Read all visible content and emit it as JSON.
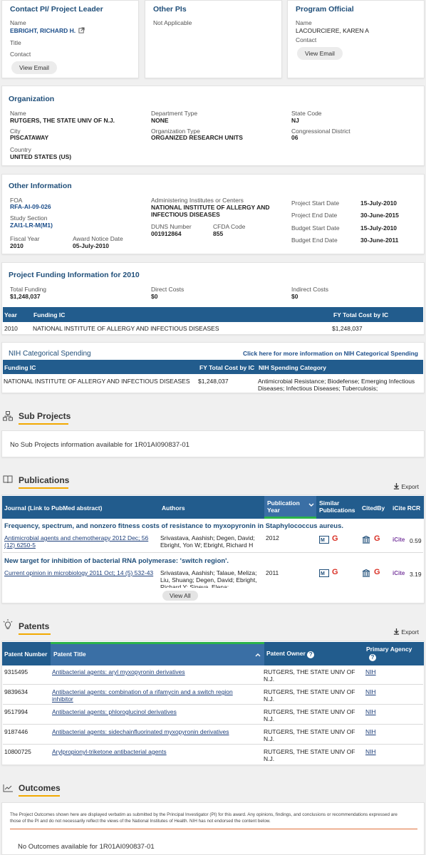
{
  "leaders": {
    "pi": {
      "title": "Contact PI/ Project Leader",
      "name_label": "Name",
      "name": "EBRIGHT, RICHARD H.",
      "title_label": "Title",
      "contact_label": "Contact",
      "button": "View Email"
    },
    "other": {
      "title": "Other PIs",
      "value": "Not Applicable"
    },
    "po": {
      "title": "Program Official",
      "name_label": "Name",
      "name": "LACOURCIERE, KAREN A",
      "contact_label": "Contact",
      "button": "View Email"
    }
  },
  "organization": {
    "title": "Organization",
    "name_label": "Name",
    "name": "RUTGERS, THE STATE UNIV OF N.J.",
    "city_label": "City",
    "city": "PISCATAWAY",
    "country_label": "Country",
    "country": "UNITED STATES (US)",
    "dept_label": "Department Type",
    "dept": "NONE",
    "orgtype_label": "Organization Type",
    "orgtype": "ORGANIZED RESEARCH UNITS",
    "state_label": "State Code",
    "state": "NJ",
    "district_label": "Congressional District",
    "district": "06"
  },
  "other_info": {
    "title": "Other Information",
    "foa_label": "FOA",
    "foa": "RFA-AI-09-026",
    "study_label": "Study Section",
    "study": "ZAI1-LR-M(M1)",
    "fy_label": "Fiscal Year",
    "fy": "2010",
    "award_label": "Award Notice Date",
    "award": "05-July-2010",
    "admin_label": "Administering Institutes or Centers",
    "admin": "NATIONAL INSTITUTE OF ALLERGY AND INFECTIOUS DISEASES",
    "duns_label": "DUNS Number",
    "duns": "001912864",
    "cfda_label": "CFDA Code",
    "cfda": "855",
    "dates": [
      {
        "label": "Project Start Date",
        "value": "15-July-2010"
      },
      {
        "label": "Project End Date",
        "value": "30-June-2015"
      },
      {
        "label": "Budget Start Date",
        "value": "15-July-2010"
      },
      {
        "label": "Budget End Date",
        "value": "30-June-2011"
      }
    ]
  },
  "funding": {
    "title": "Project Funding Information for 2010",
    "total_label": "Total Funding",
    "total": "$1,248,037",
    "direct_label": "Direct Costs",
    "direct": "$0",
    "indirect_label": "Indirect Costs",
    "indirect": "$0",
    "headers": [
      "Year",
      "Funding IC",
      "FY Total Cost by IC"
    ],
    "row": [
      "2010",
      "NATIONAL INSTITUTE OF ALLERGY AND INFECTIOUS DISEASES",
      "$1,248,037"
    ]
  },
  "categorical": {
    "title": "NIH Categorical Spending",
    "link": "Click here for more information on NIH Categorical Spending",
    "headers": [
      "Funding IC",
      "FY Total Cost by IC",
      "NIH Spending Category"
    ],
    "row": [
      "NATIONAL INSTITUTE OF ALLERGY AND INFECTIOUS DISEASES",
      "$1,248,037",
      "Antimicrobial Resistance; Biodefense; Emerging Infectious Diseases; Infectious Diseases; Tuberculosis;"
    ]
  },
  "subprojects": {
    "title": "Sub Projects",
    "empty": "No Sub Projects information available for 1R01AI090837-01"
  },
  "publications": {
    "title": "Publications",
    "export": "Export",
    "headers": {
      "journal": "Journal (Link to PubMed abstract)",
      "authors": "Authors",
      "pubyear": "Publication Year",
      "similar": "Similar Publications",
      "citedby": "CitedBy",
      "icite": "iCite RCR"
    },
    "items": [
      {
        "title": "Frequency, spectrum, and nonzero fitness costs of resistance to myxopyronin in Staphylococcus aureus.",
        "journal": "Antimicrobial agents and chemotherapy 2012 Dec; 56 (12) 6250-5",
        "authors": "Srivastava, Aashish; Degen, David; Ebright, Yon W; Ebright, Richard H",
        "year": "2012",
        "rcr": "0.59"
      },
      {
        "title": "New target for inhibition of bacterial RNA polymerase: 'switch region'.",
        "journal": "Current opinion in microbiology 2011 Oct; 14 (5) 532-43",
        "authors": "Srivastava, Aashish; Talaue, Meliza; Liu, Shuang; Degen, David; Ebright, Richard Y; Sineva, Elena;",
        "year": "2011",
        "rcr": "3.19"
      }
    ],
    "view_all": "View All"
  },
  "patents": {
    "title": "Patents",
    "export": "Export",
    "headers": {
      "number": "Patent Number",
      "title": "Patent Title",
      "owner": "Patent Owner",
      "agency": "Primary Agency"
    },
    "items": [
      {
        "number": "9315495",
        "title": "Antibacterial agents: aryl myxopyronin derivatives",
        "owner": "RUTGERS, THE STATE UNIV OF N.J.",
        "agency": "NIH"
      },
      {
        "number": "9839634",
        "title": "Antibacterial agents: combination of a rifamycin and a switch region inhibitor",
        "owner": "RUTGERS, THE STATE UNIV OF N.J.",
        "agency": "NIH"
      },
      {
        "number": "9517994",
        "title": "Antibacterial agents: phloroglucinol derivatives",
        "owner": "RUTGERS, THE STATE UNIV OF N.J.",
        "agency": "NIH"
      },
      {
        "number": "9187446",
        "title": "Antibacterial agents: sidechainfluorinated myxopyronin derivatives",
        "owner": "RUTGERS, THE STATE UNIV OF N.J.",
        "agency": "NIH"
      },
      {
        "number": "10800725",
        "title": "Arylpropionyl-triketone antibacterial agents",
        "owner": "RUTGERS, THE STATE UNIV OF N.J.",
        "agency": "NIH"
      }
    ]
  },
  "outcomes": {
    "title": "Outcomes",
    "disclaimer": "The Project Outcomes shown here are displayed verbatim as submitted by the Principal Investigator (PI) for this award. Any opinions, findings, and conclusions or recommendations expressed are those of the PI and do not necessarily reflect the views of the National Institutes of Health. NIH has not endorsed the content below.",
    "empty": "No Outcomes available for 1R01AI090837-01"
  },
  "colors": {
    "header_blue": "#225c8d",
    "title_blue": "#1f4e79",
    "accent_orange": "#f2a900",
    "active_green": "#2cb34a"
  }
}
